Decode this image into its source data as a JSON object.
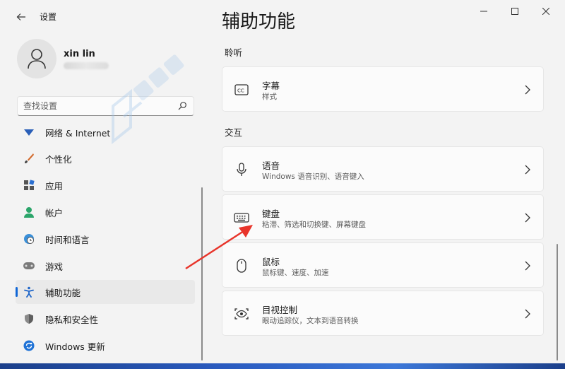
{
  "window": {
    "app_title": "设置"
  },
  "profile": {
    "name": "xin lin"
  },
  "search": {
    "placeholder": "查找设置"
  },
  "sidebar": {
    "items": [
      {
        "label": "网络 & Internet",
        "icon": "network-icon"
      },
      {
        "label": "个性化",
        "icon": "brush-icon"
      },
      {
        "label": "应用",
        "icon": "apps-icon"
      },
      {
        "label": "帐户",
        "icon": "account-icon"
      },
      {
        "label": "时间和语言",
        "icon": "globe-clock-icon"
      },
      {
        "label": "游戏",
        "icon": "gamepad-icon"
      },
      {
        "label": "辅助功能",
        "icon": "accessibility-icon",
        "active": true
      },
      {
        "label": "隐私和安全性",
        "icon": "shield-icon"
      },
      {
        "label": "Windows 更新",
        "icon": "update-icon"
      }
    ]
  },
  "main": {
    "title": "辅助功能",
    "sections": [
      {
        "label": "聆听",
        "cards": [
          {
            "title": "字幕",
            "subtitle": "样式",
            "icon": "captions-icon"
          }
        ]
      },
      {
        "label": "交互",
        "cards": [
          {
            "title": "语音",
            "subtitle": "Windows 语音识别、语音键入",
            "icon": "microphone-icon"
          },
          {
            "title": "键盘",
            "subtitle": "粘滞、筛选和切换键、屏幕键盘",
            "icon": "keyboard-icon"
          },
          {
            "title": "鼠标",
            "subtitle": "鼠标键、速度、加速",
            "icon": "mouse-icon"
          },
          {
            "title": "目视控制",
            "subtitle": "眼动追踪仪，文本到语音转换",
            "icon": "eye-control-icon"
          }
        ]
      }
    ]
  },
  "colors": {
    "accent": "#1167d6",
    "annotation_arrow": "#e8342a"
  }
}
